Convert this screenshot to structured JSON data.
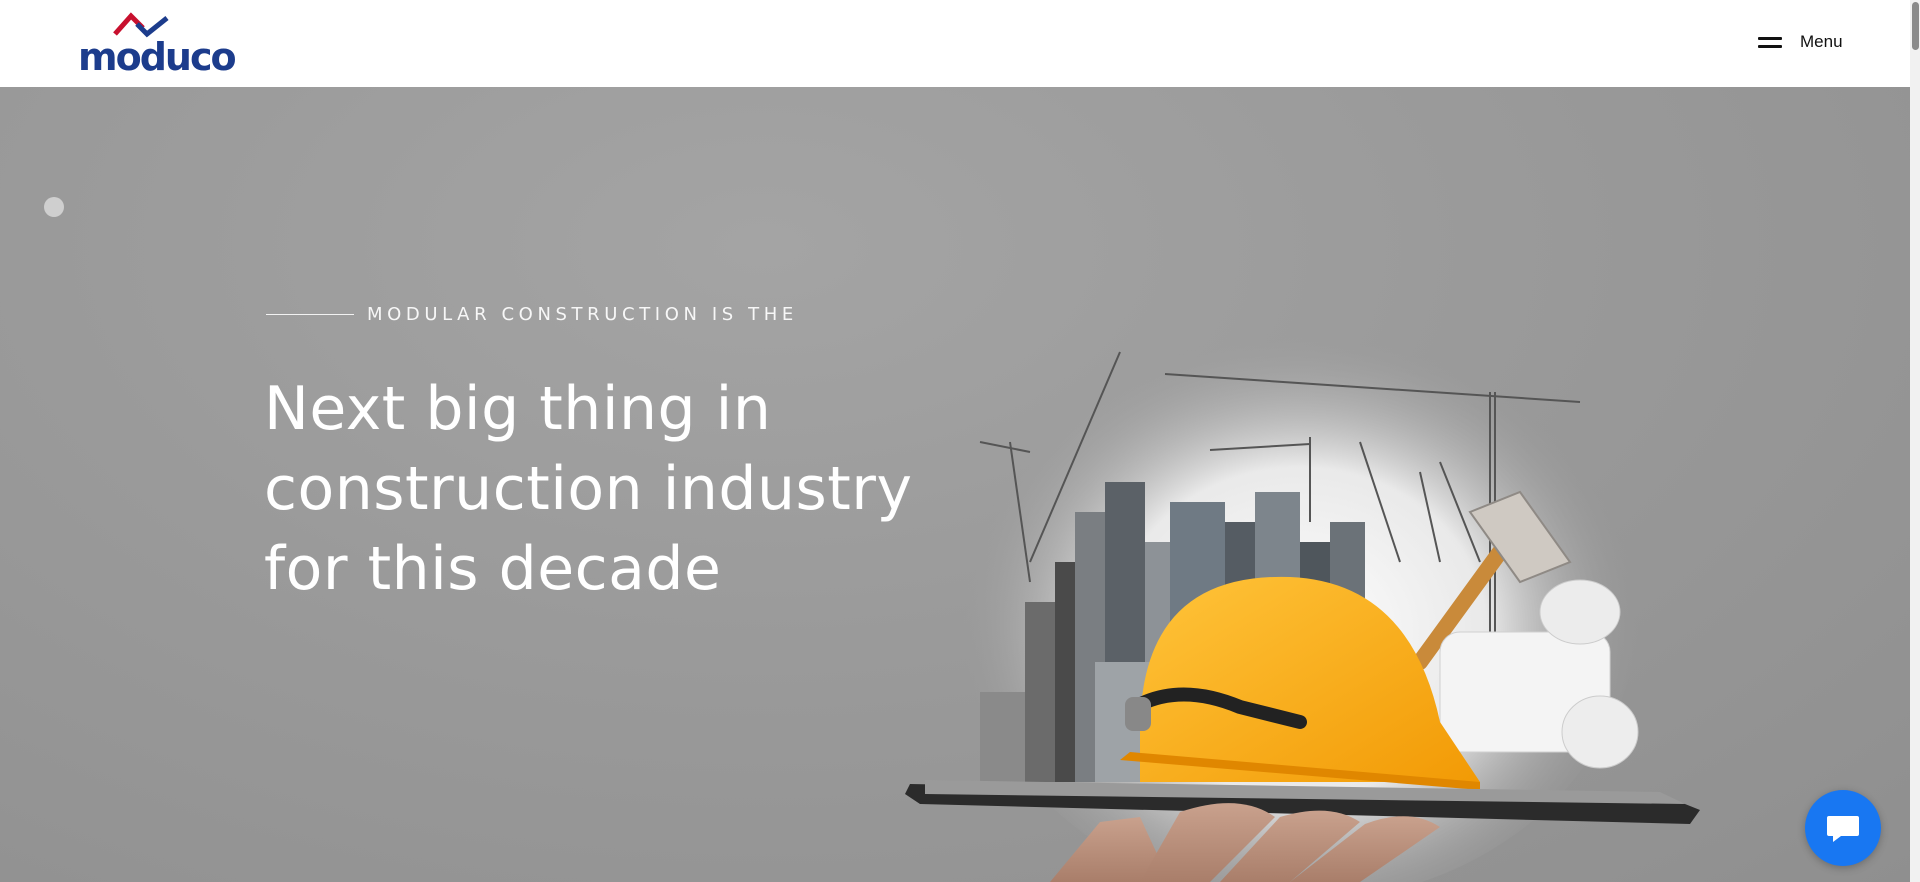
{
  "brand": {
    "logo_text": "moduco",
    "logo_alt": "moduco-logo",
    "colors": {
      "navy": "#1c3c8c",
      "red": "#c8102e"
    }
  },
  "nav": {
    "menu_label": "Menu",
    "menu_icon": "hamburger-icon"
  },
  "hero": {
    "eyebrow": "MODULAR CONSTRUCTION IS THE",
    "headline_lines": [
      "Next big thing in",
      "construction industry",
      "for this decade"
    ],
    "image": "hand-holding-tablet-with-city-helmet-crane-illustration"
  },
  "chat": {
    "icon": "chat-bubble-icon",
    "color": "#1877f2"
  }
}
